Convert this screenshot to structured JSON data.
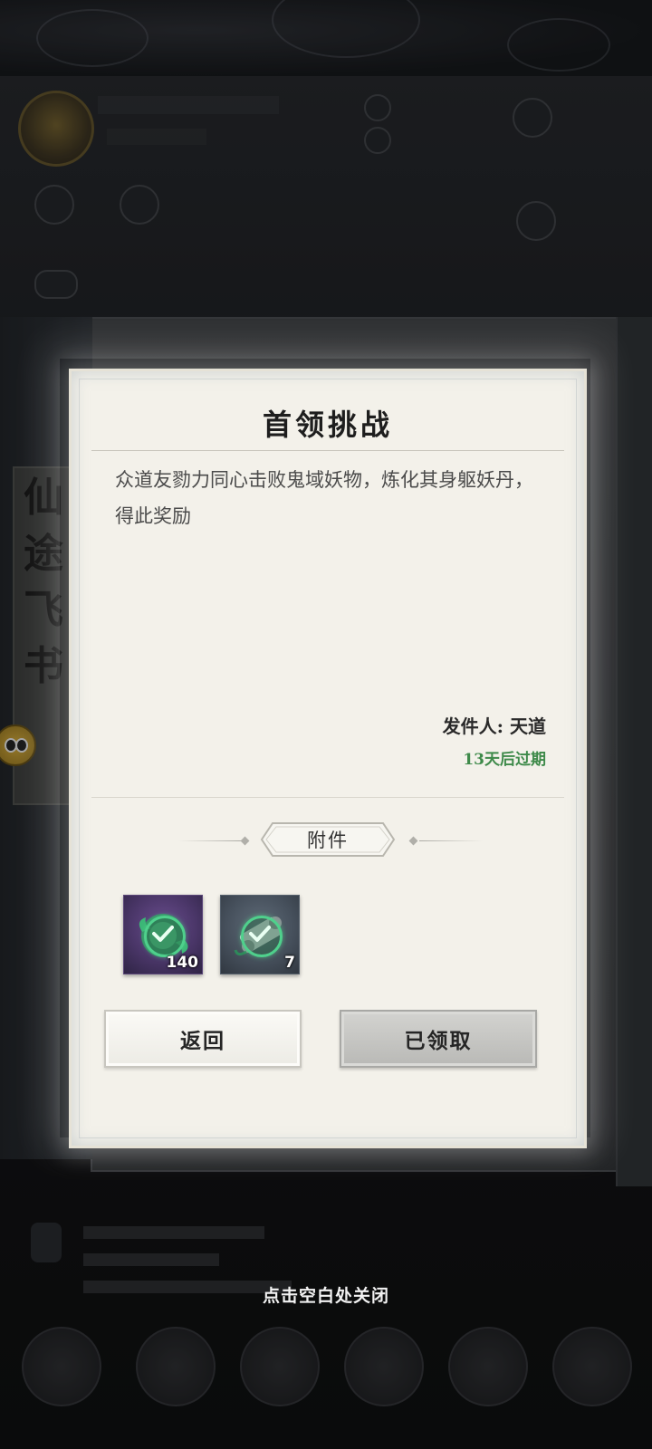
{
  "dialog": {
    "title": "首领挑战",
    "body": "众道友勠力同心击败鬼域妖物，炼化其身躯妖丹，得此奖励",
    "sender_label": "发件人: 天道",
    "expiry": "13天后过期",
    "attachment_label": "附件",
    "items": [
      {
        "quantity": "140",
        "icon": "green-spirit-orb-icon",
        "claimed": true
      },
      {
        "quantity": "7",
        "icon": "scroll-icon",
        "claimed": true
      }
    ],
    "back_button": "返回",
    "claimed_button": "已领取"
  },
  "close_hint": "点击空白处关闭",
  "background": {
    "side_scroll_title": [
      "仙",
      "途",
      "飞",
      "书"
    ]
  },
  "colors": {
    "expiry_green": "#3e8a4a",
    "dialog_paper": "#f3f1ea",
    "check_green": "#4fd08c"
  }
}
